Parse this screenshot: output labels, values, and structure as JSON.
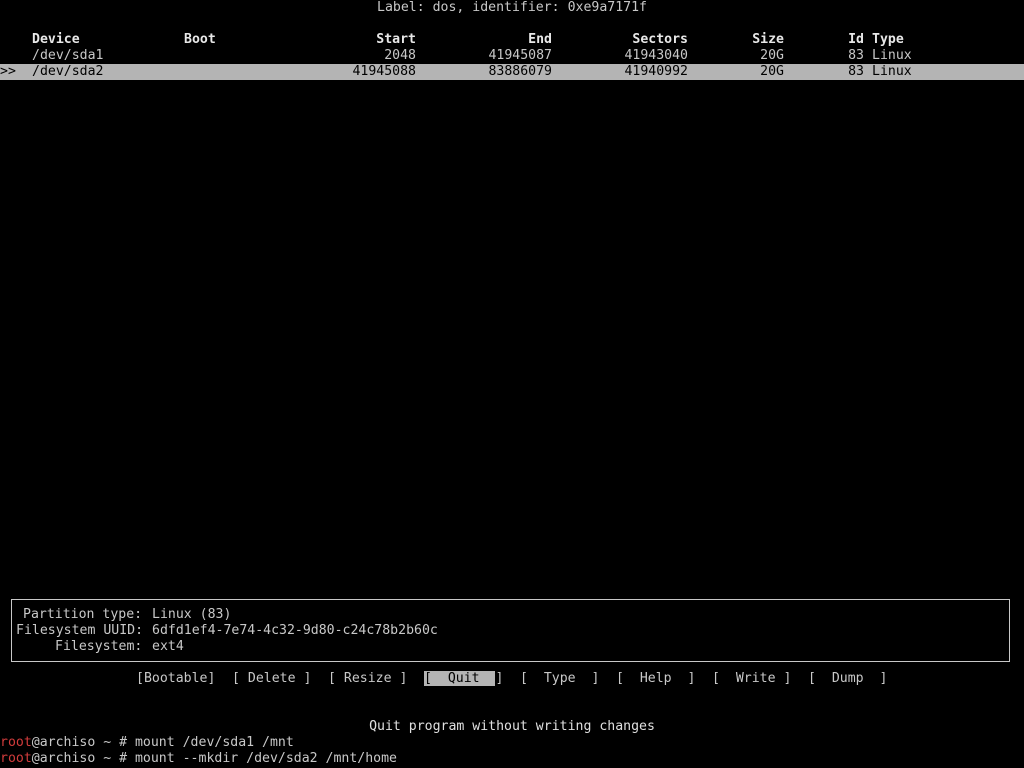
{
  "disk_label": "Label: dos, identifier: 0xe9a7171f",
  "columns": {
    "device": "Device",
    "boot": "Boot",
    "start": "Start",
    "end": "End",
    "sectors": "Sectors",
    "size": "Size",
    "id": "Id",
    "type": "Type"
  },
  "partitions": [
    {
      "marker": "",
      "device": "/dev/sda1",
      "boot": "",
      "start": "2048",
      "end": "41945087",
      "sectors": "41943040",
      "size": "20G",
      "id": "83",
      "type": "Linux"
    },
    {
      "marker": ">>",
      "device": "/dev/sda2",
      "boot": "",
      "start": "41945088",
      "end": "83886079",
      "sectors": "41940992",
      "size": "20G",
      "id": "83",
      "type": "Linux"
    }
  ],
  "info": {
    "partition_type_label": "Partition type:",
    "partition_type_value": "Linux (83)",
    "uuid_label": "Filesystem UUID:",
    "uuid_value": "6dfd1ef4-7e74-4c32-9d80-c24c78b2b60c",
    "filesystem_label": "Filesystem:",
    "filesystem_value": "ext4"
  },
  "menu": {
    "bootable": "Bootable",
    "delete": " Delete ",
    "resize": " Resize ",
    "quit": "  Quit  ",
    "type": "  Type  ",
    "help": "  Help  ",
    "write": "  Write ",
    "dump": "  Dump  "
  },
  "status_message": "Quit program without writing changes",
  "shell": [
    {
      "user": "root",
      "host_path": "@archiso ~ # ",
      "command": "mount /dev/sda1 /mnt"
    },
    {
      "user": "root",
      "host_path": "@archiso ~ # ",
      "command": "mount --mkdir /dev/sda2 /mnt/home"
    }
  ]
}
